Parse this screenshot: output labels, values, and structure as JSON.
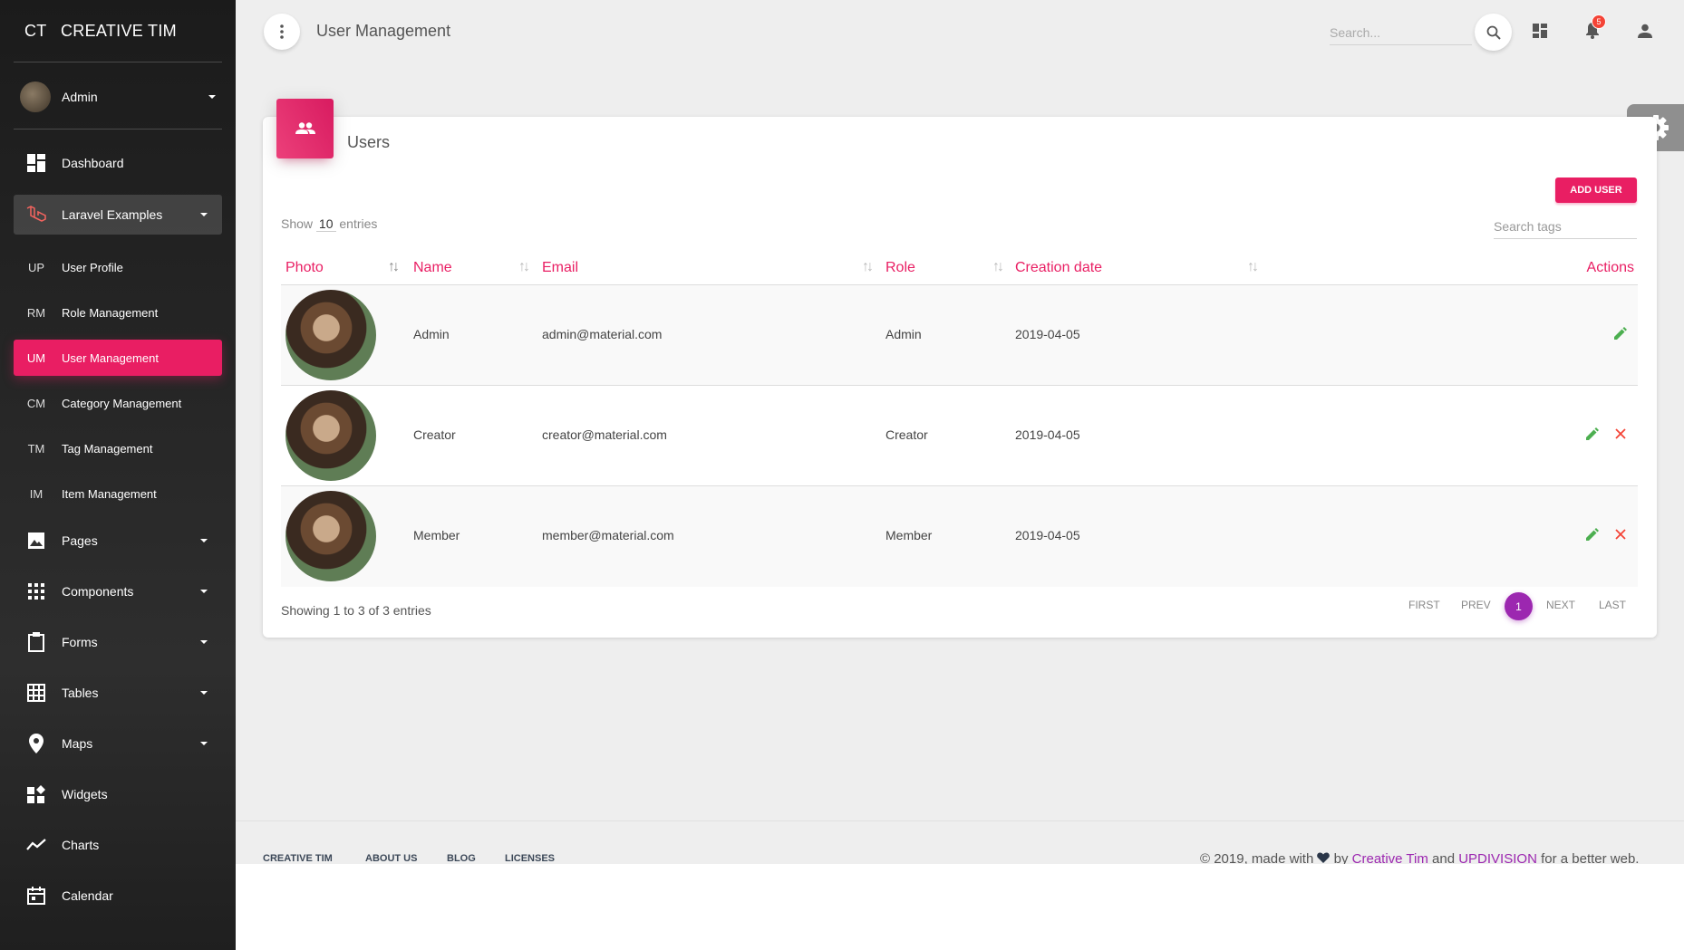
{
  "brand": {
    "mini": "CT",
    "name": "CREATIVE TIM"
  },
  "user": {
    "name": "Admin"
  },
  "nav": {
    "dashboard": "Dashboard",
    "laravel_examples": "Laravel Examples",
    "sub_items": [
      {
        "abbr": "UP",
        "label": "User Profile"
      },
      {
        "abbr": "RM",
        "label": "Role Management"
      },
      {
        "abbr": "UM",
        "label": "User Management"
      },
      {
        "abbr": "CM",
        "label": "Category Management"
      },
      {
        "abbr": "TM",
        "label": "Tag Management"
      },
      {
        "abbr": "IM",
        "label": "Item Management"
      }
    ],
    "pages": "Pages",
    "components": "Components",
    "forms": "Forms",
    "tables": "Tables",
    "maps": "Maps",
    "widgets": "Widgets",
    "charts": "Charts",
    "calendar": "Calendar"
  },
  "topbar": {
    "title": "User Management",
    "search_placeholder": "Search...",
    "notification_count": "5"
  },
  "card": {
    "title": "Users",
    "add_button": "ADD USER",
    "show_prefix": "Show",
    "show_count": "10",
    "show_suffix": "entries",
    "tag_search_placeholder": "Search tags",
    "columns": {
      "photo": "Photo",
      "name": "Name",
      "email": "Email",
      "role": "Role",
      "created": "Creation date",
      "actions": "Actions"
    },
    "rows": [
      {
        "name": "Admin",
        "email": "admin@material.com",
        "role": "Admin",
        "created": "2019-04-05"
      },
      {
        "name": "Creator",
        "email": "creator@material.com",
        "role": "Creator",
        "created": "2019-04-05"
      },
      {
        "name": "Member",
        "email": "member@material.com",
        "role": "Member",
        "created": "2019-04-05"
      }
    ],
    "showing": "Showing 1 to 3 of 3 entries",
    "pagination": {
      "first": "FIRST",
      "prev": "PREV",
      "current": "1",
      "next": "NEXT",
      "last": "LAST"
    }
  },
  "footer": {
    "links": [
      "CREATIVE TIM",
      "ABOUT US",
      "BLOG",
      "LICENSES"
    ],
    "copy_prefix": "© 2019, made with",
    "copy_by": "by",
    "author1": "Creative Tim",
    "copy_and": "and",
    "author2": "UPDIVISION",
    "copy_suffix": "for a better web."
  },
  "colors": {
    "accent": "#e91e63",
    "purple": "#9c27b0",
    "edit": "#4caf50",
    "delete": "#f44336"
  }
}
